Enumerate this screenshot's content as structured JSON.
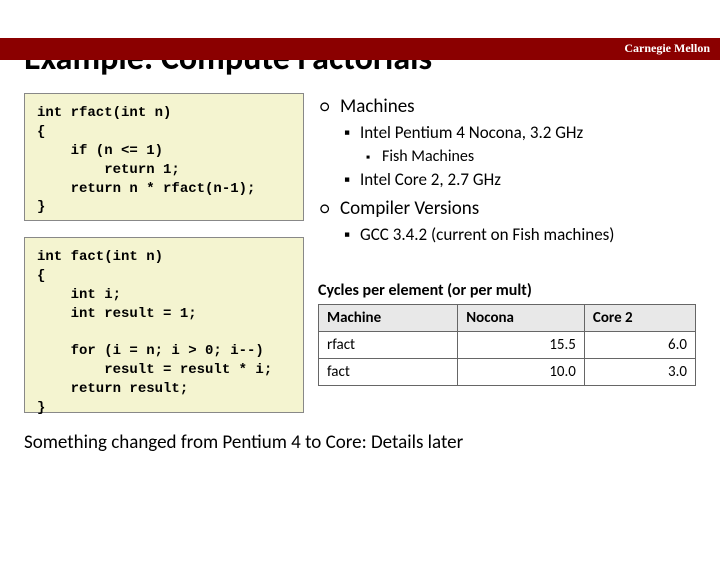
{
  "header": {
    "brand": "Carnegie Mellon"
  },
  "title": "Example: Compute Factorials",
  "code": {
    "rfact": "int rfact(int n)\n{\n    if (n <= 1)\n        return 1;\n    return n * rfact(n-1);\n}",
    "fact": "int fact(int n)\n{\n    int i;\n    int result = 1;\n\n    for (i = n; i > 0; i--)\n        result = result * i;\n    return result;\n}"
  },
  "bullets": {
    "machines_label": "Machines",
    "machines": {
      "p4": "Intel Pentium 4 Nocona, 3.2 GHz",
      "fish": "Fish Machines",
      "core2": "Intel Core 2, 2.7 GHz"
    },
    "compiler_label": "Compiler Versions",
    "compiler": {
      "gcc": "GCC 3.4.2 (current on Fish machines)"
    }
  },
  "table": {
    "caption": "Cycles per element (or per mult)",
    "headers": {
      "machine": "Machine",
      "nocona": "Nocona",
      "core2": "Core 2"
    },
    "rows": [
      {
        "name": "rfact",
        "nocona": "15.5",
        "core2": "6.0"
      },
      {
        "name": "fact",
        "nocona": "10.0",
        "core2": "3.0"
      }
    ]
  },
  "footer": "Something changed from Pentium 4 to Core: Details later",
  "chart_data": {
    "type": "table",
    "title": "Cycles per element (or per mult)",
    "columns": [
      "Machine",
      "Nocona",
      "Core 2"
    ],
    "rows": [
      [
        "rfact",
        15.5,
        6.0
      ],
      [
        "fact",
        10.0,
        3.0
      ]
    ]
  }
}
